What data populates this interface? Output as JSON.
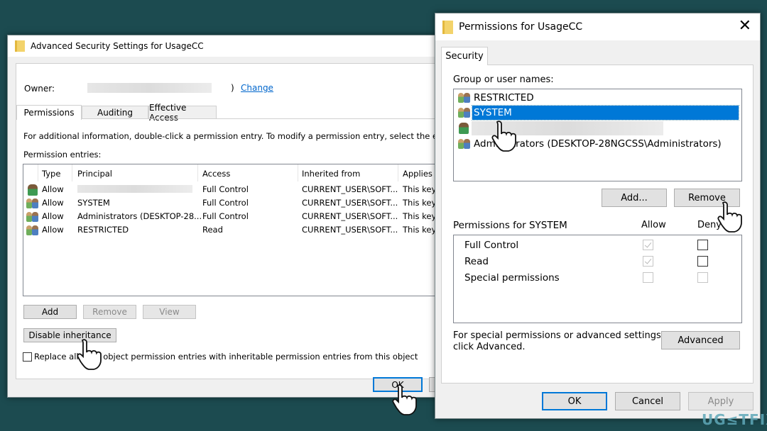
{
  "advanced_dialog": {
    "title": "Advanced Security Settings for UsageCC",
    "owner_label": "Owner:",
    "owner_suffix": ")",
    "change_link": "Change",
    "tabs": [
      {
        "label": "Permissions",
        "active": true
      },
      {
        "label": "Auditing"
      },
      {
        "label": "Effective Access"
      }
    ],
    "info_text": "For additional information, double-click a permission entry. To modify a permission entry, select the entry and c",
    "entries_label": "Permission entries:",
    "columns": [
      "Type",
      "Principal",
      "Access",
      "Inherited from",
      "Applies t"
    ],
    "rows": [
      {
        "icon": "user-icon",
        "type": "Allow",
        "principal": "",
        "access": "Full Control",
        "inherited": "CURRENT_USER\\SOFT...",
        "applies": "This key"
      },
      {
        "icon": "group-icon",
        "type": "Allow",
        "principal": "SYSTEM",
        "access": "Full Control",
        "inherited": "CURRENT_USER\\SOFT...",
        "applies": "This key"
      },
      {
        "icon": "group-icon",
        "type": "Allow",
        "principal": "Administrators (DESKTOP-28...",
        "access": "Full Control",
        "inherited": "CURRENT_USER\\SOFT...",
        "applies": "This key"
      },
      {
        "icon": "group-icon",
        "type": "Allow",
        "principal": "RESTRICTED",
        "access": "Read",
        "inherited": "CURRENT_USER\\SOFT...",
        "applies": "This key"
      }
    ],
    "add_label": "Add",
    "remove_label": "Remove",
    "view_label": "View",
    "disable_inheritance_label": "Disable inheritance",
    "replace_checkbox_label": "Replace all child object permission entries with inheritable permission entries from this object",
    "replace_checked": false,
    "ok_label": "OK"
  },
  "permissions_dialog": {
    "title": "Permissions for UsageCC",
    "tab": "Security",
    "group_label": "Group or user names:",
    "users": [
      {
        "icon": "group-icon",
        "name": "RESTRICTED"
      },
      {
        "icon": "group-icon",
        "name": "SYSTEM",
        "selected": true
      },
      {
        "icon": "user-icon",
        "name": ""
      },
      {
        "icon": "group-icon",
        "name": "Administrators (DESKTOP-28NGCSS\\Administrators)"
      }
    ],
    "add_label": "Add...",
    "remove_label": "Remove",
    "perm_label": "Permissions for SYSTEM",
    "allow_label": "Allow",
    "deny_label": "Deny",
    "perms": [
      {
        "name": "Full Control",
        "allow": true,
        "deny": false
      },
      {
        "name": "Read",
        "allow": true,
        "deny": false
      },
      {
        "name": "Special permissions",
        "allow": false,
        "deny": false
      }
    ],
    "advanced_text_1": "For special permissions or advanced settings,",
    "advanced_text_2": "click Advanced.",
    "advanced_label": "Advanced",
    "ok_label": "OK",
    "cancel_label": "Cancel",
    "apply_label": "Apply"
  },
  "watermark": "UG≤TFIX",
  "colors": {
    "selection": "#0078d7",
    "link": "#0066cc",
    "background": "#1c4b50"
  }
}
